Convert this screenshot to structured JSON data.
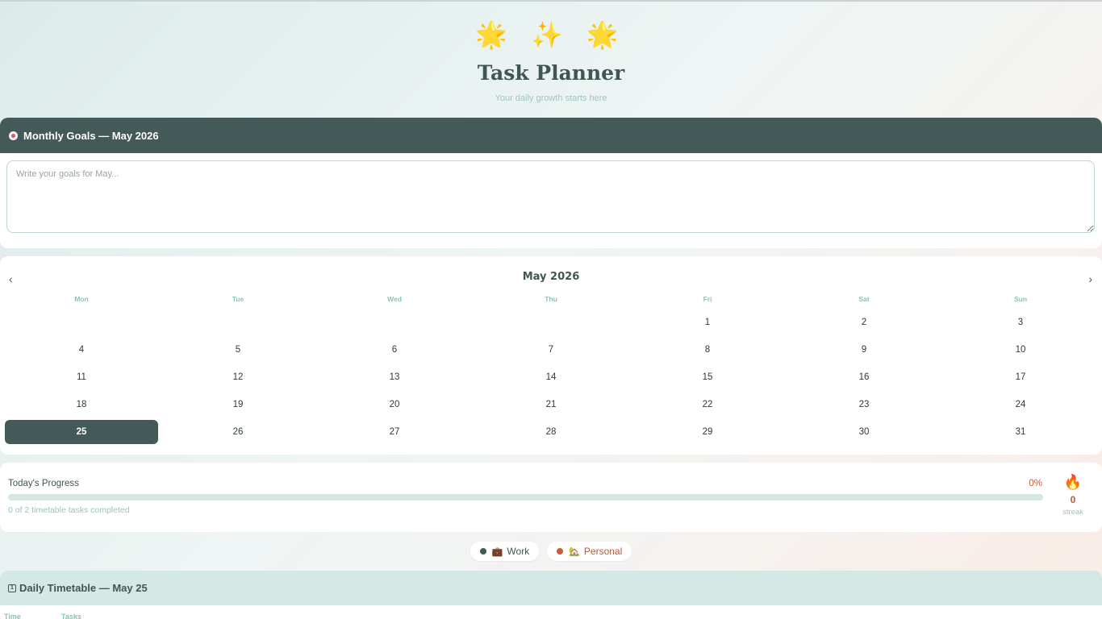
{
  "header": {
    "stars": "🌟 ✨ 🌟",
    "title": "Task Planner",
    "subtitle": "Your daily growth starts here"
  },
  "goals": {
    "icon": "target-icon",
    "title": "Monthly Goals — May 2026",
    "placeholder": "Write your goals for May...",
    "value": ""
  },
  "calendar": {
    "prev_label": "‹",
    "next_label": "›",
    "month_title": "May 2026",
    "weekdays": [
      "Mon",
      "Tue",
      "Wed",
      "Thu",
      "Fri",
      "Sat",
      "Sun"
    ],
    "leading_blanks": 4,
    "days": [
      "1",
      "2",
      "3",
      "4",
      "5",
      "6",
      "7",
      "8",
      "9",
      "10",
      "11",
      "12",
      "13",
      "14",
      "15",
      "16",
      "17",
      "18",
      "19",
      "20",
      "21",
      "22",
      "23",
      "24",
      "25",
      "26",
      "27",
      "28",
      "29",
      "30",
      "31"
    ],
    "selected_day": "25"
  },
  "progress": {
    "label": "Today's Progress",
    "percent_text": "0%",
    "fraction": 0,
    "summary": "0 of 2 timetable tasks completed",
    "streak_icon": "🔥",
    "streak_count": "0",
    "streak_label": "streak"
  },
  "legend": [
    {
      "icon": "💼",
      "label": "Work",
      "color": "#435a58"
    },
    {
      "icon": "🏡",
      "label": "Personal",
      "color": "#c75b3b"
    }
  ],
  "timetable": {
    "title": "Daily Timetable — May 25",
    "icon_text": "1",
    "columns": [
      "Time",
      "Tasks"
    ]
  },
  "colors": {
    "primary": "#435a58",
    "accent": "#c75b3b",
    "muted": "#8cc1b6"
  }
}
